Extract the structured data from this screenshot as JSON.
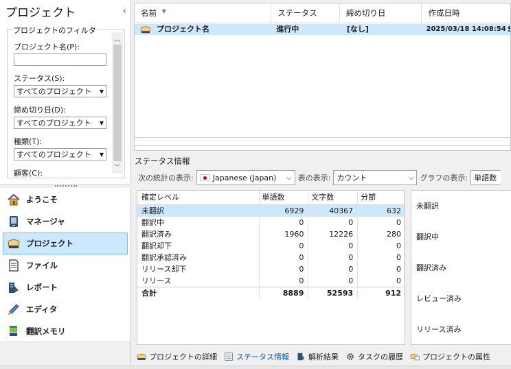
{
  "left_panel": {
    "title": "プロジェクト",
    "filter": {
      "legend": "プロジェクトのフィルタ",
      "name_label": "プロジェクト名(P):",
      "name_value": "",
      "status_label": "ステータス(S):",
      "status_value": "すべてのプロジェクトの表示",
      "due_label": "締め切り日(D):",
      "due_value": "すべてのプロジェクトの表示",
      "type_label": "種類(T):",
      "type_value": "すべてのプロジェクトの表示",
      "customer_label": "顧客(C):"
    },
    "nav": [
      {
        "label": "ようこそ",
        "icon": "home-icon"
      },
      {
        "label": "マネージャ",
        "icon": "manager-icon"
      },
      {
        "label": "プロジェクト",
        "icon": "project-icon",
        "selected": true
      },
      {
        "label": "ファイル",
        "icon": "file-icon"
      },
      {
        "label": "レポート",
        "icon": "report-icon"
      },
      {
        "label": "エディタ",
        "icon": "editor-icon"
      },
      {
        "label": "翻訳メモリ",
        "icon": "translation-memory-icon"
      }
    ]
  },
  "project_grid": {
    "columns": [
      "名前",
      "ステータス",
      "締め切り日",
      "作成日時"
    ],
    "row": {
      "name": "プロジェクト名",
      "status": "進行中",
      "due": "[なし]",
      "created": "2025/03/18 14:08:54",
      "extra": "S"
    }
  },
  "status_info": {
    "title": "ステータス情報",
    "stats_label": "次の統計の表示:",
    "language": "Japanese (Japan)",
    "table_label": "表の表示:",
    "table_mode": "カウント",
    "graph_label": "グラフの表示:",
    "graph_mode": "単語数",
    "table": {
      "headers": [
        "確定レベル",
        "単語数",
        "文字数",
        "分節"
      ],
      "rows": [
        [
          "未翻訳",
          "6929",
          "40367",
          "632"
        ],
        [
          "翻訳中",
          "0",
          "0",
          "0"
        ],
        [
          "翻訳済み",
          "1960",
          "12226",
          "280"
        ],
        [
          "翻訳却下",
          "0",
          "0",
          "0"
        ],
        [
          "翻訳承認済み",
          "0",
          "0",
          "0"
        ],
        [
          "リリース却下",
          "0",
          "0",
          "0"
        ],
        [
          "リリース",
          "0",
          "0",
          "0"
        ]
      ],
      "total": [
        "合計",
        "8889",
        "52593",
        "912"
      ]
    },
    "chart_labels": [
      "未翻訳",
      "翻訳中",
      "翻訳済み",
      "レビュー済み",
      "リリース済み"
    ]
  },
  "tabs": [
    {
      "label": "プロジェクトの詳細",
      "icon": "project-details-icon"
    },
    {
      "label": "ステータス情報",
      "icon": "status-info-icon",
      "selected": true
    },
    {
      "label": "解析結果",
      "icon": "analysis-icon"
    },
    {
      "label": "タスクの履歴",
      "icon": "task-history-icon"
    },
    {
      "label": "プロジェクトの属性",
      "icon": "project-attributes-icon"
    }
  ],
  "colors": {
    "selection": "#cce8ff",
    "accent": "#0b57a8"
  }
}
